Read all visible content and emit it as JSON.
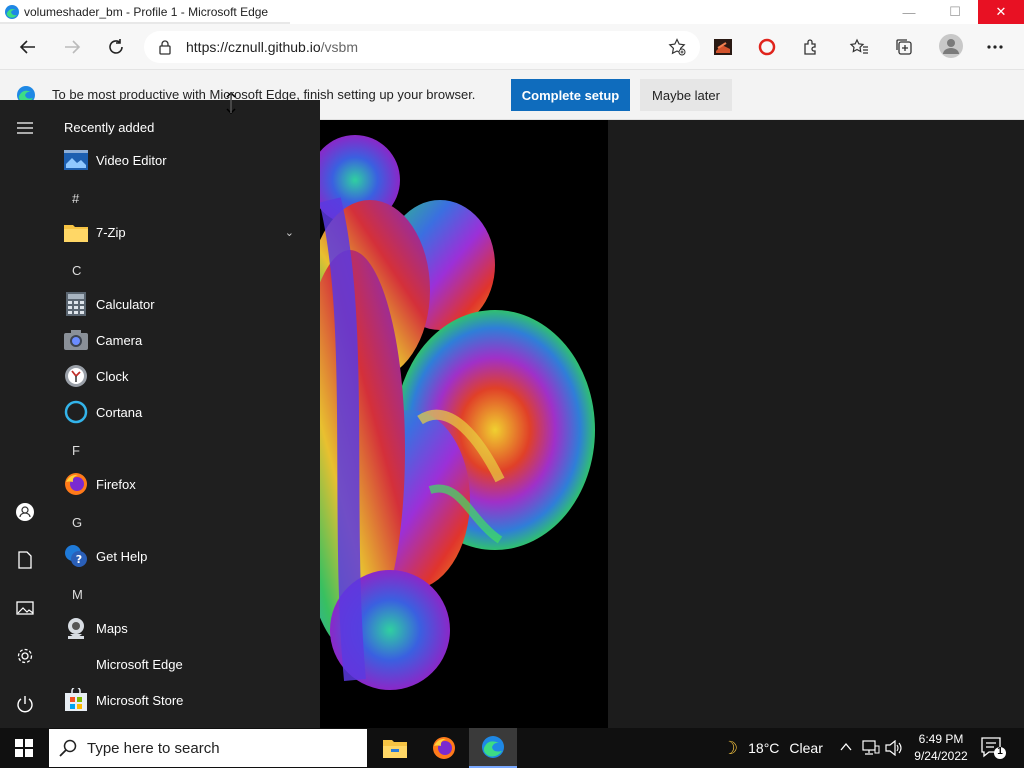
{
  "window": {
    "title": "volumeshader_bm - Profile 1 - Microsoft Edge",
    "minimize_glyph": "—",
    "maximize_glyph": "☐",
    "close_glyph": "✕"
  },
  "navigation": {
    "url_host": "https://cznull.github.io",
    "url_path": "/vsbm"
  },
  "infobar": {
    "message": "To be most productive with Microsoft Edge, finish setting up your browser.",
    "complete_setup_label": "Complete setup",
    "maybe_later_label": "Maybe later"
  },
  "start_menu": {
    "recently_added_label": "Recently added",
    "recent_app": "Video Editor",
    "sections": [
      {
        "letter": "#",
        "apps": [
          "7-Zip"
        ]
      },
      {
        "letter": "C",
        "apps": [
          "Calculator",
          "Camera",
          "Clock",
          "Cortana"
        ]
      },
      {
        "letter": "F",
        "apps": [
          "Firefox"
        ]
      },
      {
        "letter": "G",
        "apps": [
          "Get Help"
        ]
      },
      {
        "letter": "M",
        "apps": [
          "Maps",
          "Microsoft Edge",
          "Microsoft Store"
        ]
      }
    ]
  },
  "taskbar": {
    "search_placeholder": "Type here to search",
    "weather_temp": "18°C",
    "weather_condition": "Clear",
    "time": "6:49 PM",
    "date": "9/24/2022",
    "notification_count": "1"
  },
  "colors": {
    "accent_blue": "#0f6cbd",
    "close_red": "#e81123",
    "start_menu_bg": "#1f1f1f",
    "taskbar_bg": "#101010"
  }
}
